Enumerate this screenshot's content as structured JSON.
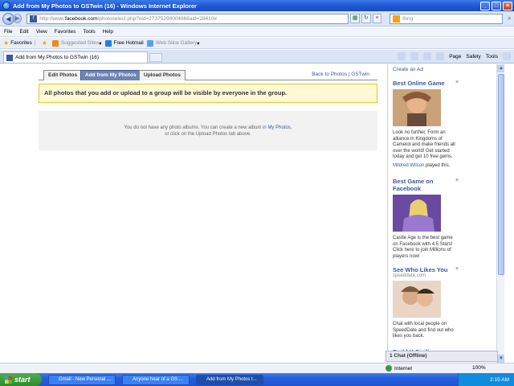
{
  "window": {
    "title": "Add from My Photos to GSTwin (16) - Windows Internet Explorer",
    "url_prefix": "http://www.",
    "url_host": "facebook.com",
    "url_path": "/photoselect.php?oid=27375294004668aid=28410#",
    "search_placeholder": "Bing"
  },
  "menu": [
    "File",
    "Edit",
    "View",
    "Favorites",
    "Tools",
    "Help"
  ],
  "favorites_bar": {
    "favorites_label": "Favorites",
    "suggested_sites": "Suggested Sites",
    "free_hotmail": "Free Hotmail",
    "web_slice": "Web Slice Gallery"
  },
  "tab": {
    "label": "Add from My Photos to GSTwin (16)",
    "tools": [
      "Page",
      "Safety",
      "Tools"
    ]
  },
  "photos": {
    "tabs": [
      "Edit Photos",
      "Add from My Photos",
      "Upload Photos"
    ],
    "back_link": "Back to Photos | GSTwin",
    "notice": "All photos that you add or upload to a group will be visible by everyone in the group.",
    "empty_line1": "You do not have any photo albums. You can create a new album in",
    "empty_link": "My Photos",
    "empty_line1_end": ",",
    "empty_line2": "or click on the Upload Photos tab above."
  },
  "sidebar": {
    "create_ad": "Create an Ad",
    "ads": [
      {
        "title": "Best Online Game",
        "text": "Look no further. Form an alliance in Kingdoms of Camelot and make friends all over the world! Get started today and get 10 free gems.",
        "liked_by": "Mildred Wilson",
        "liked_suffix": "played this."
      },
      {
        "title": "Best Game on Facebook",
        "text": "Castle Age is the best game on Facebook with 4.5 Stars! Click here to join Millions of players now!"
      },
      {
        "title": "See Who Likes You",
        "subtitle": "speeddate.com",
        "text": "Chat with local people on SpeedDate and find out who likes you back."
      }
    ],
    "partial_ad_title": "Build Y Civiliz",
    "chat": "1 Chat (Offline)"
  },
  "statusbar": {
    "zone": "Internet",
    "zoom": "100%"
  },
  "taskbar": {
    "start": "start",
    "items": [
      "Gmail - New Personal ...",
      "Anyone hear of a GS ...",
      "Add from My Photos t..."
    ],
    "clock": "2:15 AM"
  }
}
